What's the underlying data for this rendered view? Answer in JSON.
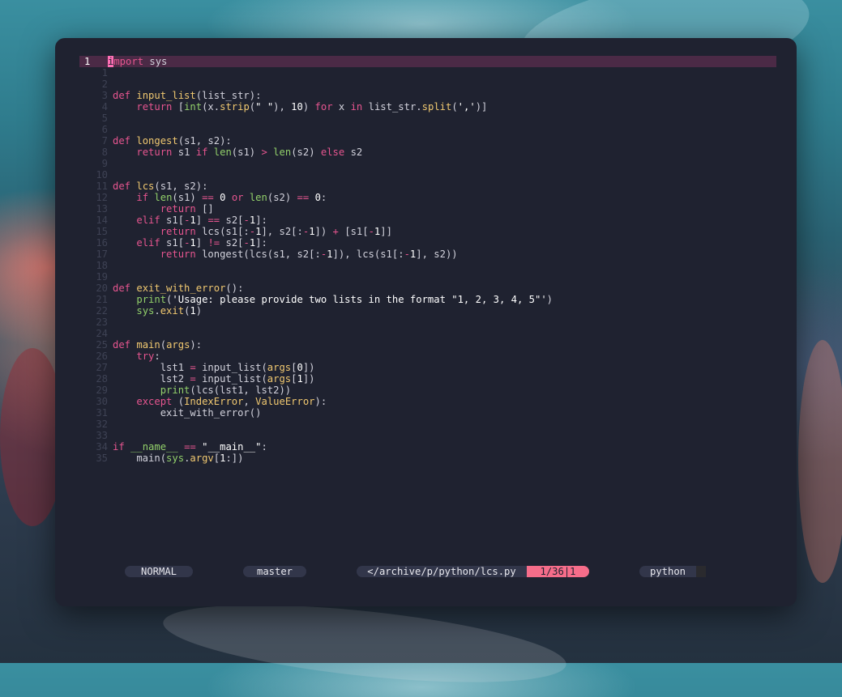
{
  "editor": {
    "current_line_number": "1",
    "lines": [
      {
        "n": "1",
        "tokens": [
          [
            "cursor",
            "i"
          ],
          [
            "kw",
            "mport"
          ],
          [
            "id",
            " sys"
          ]
        ]
      },
      {
        "n": "1",
        "tokens": []
      },
      {
        "n": "2",
        "tokens": []
      },
      {
        "n": "3",
        "tokens": [
          [
            "kw",
            "def"
          ],
          [
            "id",
            " "
          ],
          [
            "fn",
            "input_list"
          ],
          [
            "id",
            "(list_str):"
          ]
        ]
      },
      {
        "n": "4",
        "tokens": [
          [
            "id",
            "    "
          ],
          [
            "kw",
            "return"
          ],
          [
            "id",
            " ["
          ],
          [
            "bi",
            "int"
          ],
          [
            "id",
            "(x."
          ],
          [
            "fn",
            "strip"
          ],
          [
            "id",
            "("
          ],
          [
            "str",
            "\" \""
          ],
          [
            "id",
            "), "
          ],
          [
            "num",
            "10"
          ],
          [
            "id",
            ") "
          ],
          [
            "kw",
            "for"
          ],
          [
            "id",
            " x "
          ],
          [
            "kw",
            "in"
          ],
          [
            "id",
            " list_str."
          ],
          [
            "fn",
            "split"
          ],
          [
            "id",
            "("
          ],
          [
            "str",
            "','"
          ],
          [
            "id",
            ")]"
          ]
        ]
      },
      {
        "n": "5",
        "tokens": []
      },
      {
        "n": "6",
        "tokens": []
      },
      {
        "n": "7",
        "tokens": [
          [
            "kw",
            "def"
          ],
          [
            "id",
            " "
          ],
          [
            "fn",
            "longest"
          ],
          [
            "id",
            "(s1, s2):"
          ]
        ]
      },
      {
        "n": "8",
        "tokens": [
          [
            "id",
            "    "
          ],
          [
            "kw",
            "return"
          ],
          [
            "id",
            " s1 "
          ],
          [
            "kw",
            "if"
          ],
          [
            "id",
            " "
          ],
          [
            "bi",
            "len"
          ],
          [
            "id",
            "(s1) "
          ],
          [
            "op",
            ">"
          ],
          [
            "id",
            " "
          ],
          [
            "bi",
            "len"
          ],
          [
            "id",
            "(s2) "
          ],
          [
            "kw",
            "else"
          ],
          [
            "id",
            " s2"
          ]
        ]
      },
      {
        "n": "9",
        "tokens": []
      },
      {
        "n": "10",
        "tokens": []
      },
      {
        "n": "11",
        "tokens": [
          [
            "kw",
            "def"
          ],
          [
            "id",
            " "
          ],
          [
            "fn",
            "lcs"
          ],
          [
            "id",
            "(s1, s2):"
          ]
        ]
      },
      {
        "n": "12",
        "tokens": [
          [
            "id",
            "    "
          ],
          [
            "kw",
            "if"
          ],
          [
            "id",
            " "
          ],
          [
            "bi",
            "len"
          ],
          [
            "id",
            "(s1) "
          ],
          [
            "op",
            "=="
          ],
          [
            "id",
            " "
          ],
          [
            "num",
            "0"
          ],
          [
            "id",
            " "
          ],
          [
            "kw",
            "or"
          ],
          [
            "id",
            " "
          ],
          [
            "bi",
            "len"
          ],
          [
            "id",
            "(s2) "
          ],
          [
            "op",
            "=="
          ],
          [
            "id",
            " "
          ],
          [
            "num",
            "0"
          ],
          [
            "id",
            ":"
          ]
        ]
      },
      {
        "n": "13",
        "tokens": [
          [
            "id",
            "        "
          ],
          [
            "kw",
            "return"
          ],
          [
            "id",
            " []"
          ]
        ]
      },
      {
        "n": "14",
        "tokens": [
          [
            "id",
            "    "
          ],
          [
            "kw",
            "elif"
          ],
          [
            "id",
            " s1["
          ],
          [
            "op",
            "-"
          ],
          [
            "num",
            "1"
          ],
          [
            "id",
            "] "
          ],
          [
            "op",
            "=="
          ],
          [
            "id",
            " s2["
          ],
          [
            "op",
            "-"
          ],
          [
            "num",
            "1"
          ],
          [
            "id",
            "]:"
          ]
        ]
      },
      {
        "n": "15",
        "tokens": [
          [
            "id",
            "        "
          ],
          [
            "kw",
            "return"
          ],
          [
            "id",
            " lcs(s1[:"
          ],
          [
            "op",
            "-"
          ],
          [
            "num",
            "1"
          ],
          [
            "id",
            "], s2[:"
          ],
          [
            "op",
            "-"
          ],
          [
            "num",
            "1"
          ],
          [
            "id",
            "]) "
          ],
          [
            "op",
            "+"
          ],
          [
            "id",
            " [s1["
          ],
          [
            "op",
            "-"
          ],
          [
            "num",
            "1"
          ],
          [
            "id",
            "]]"
          ]
        ]
      },
      {
        "n": "16",
        "tokens": [
          [
            "id",
            "    "
          ],
          [
            "kw",
            "elif"
          ],
          [
            "id",
            " s1["
          ],
          [
            "op",
            "-"
          ],
          [
            "num",
            "1"
          ],
          [
            "id",
            "] "
          ],
          [
            "op",
            "!="
          ],
          [
            "id",
            " s2["
          ],
          [
            "op",
            "-"
          ],
          [
            "num",
            "1"
          ],
          [
            "id",
            "]:"
          ]
        ]
      },
      {
        "n": "17",
        "tokens": [
          [
            "id",
            "        "
          ],
          [
            "kw",
            "return"
          ],
          [
            "id",
            " longest(lcs(s1, s2[:"
          ],
          [
            "op",
            "-"
          ],
          [
            "num",
            "1"
          ],
          [
            "id",
            "]), lcs(s1[:"
          ],
          [
            "op",
            "-"
          ],
          [
            "num",
            "1"
          ],
          [
            "id",
            "], s2))"
          ]
        ]
      },
      {
        "n": "18",
        "tokens": []
      },
      {
        "n": "19",
        "tokens": []
      },
      {
        "n": "20",
        "tokens": [
          [
            "kw",
            "def"
          ],
          [
            "id",
            " "
          ],
          [
            "fn",
            "exit_with_error"
          ],
          [
            "id",
            "():"
          ]
        ]
      },
      {
        "n": "21",
        "tokens": [
          [
            "id",
            "    "
          ],
          [
            "bi",
            "print"
          ],
          [
            "id",
            "("
          ],
          [
            "str",
            "'Usage: please provide two lists in the format \"1, 2, 3, 4, 5\"'"
          ],
          [
            "id",
            ")"
          ]
        ]
      },
      {
        "n": "22",
        "tokens": [
          [
            "id",
            "    "
          ],
          [
            "bi",
            "sys"
          ],
          [
            "id",
            "."
          ],
          [
            "fn",
            "exit"
          ],
          [
            "id",
            "("
          ],
          [
            "num",
            "1"
          ],
          [
            "id",
            ")"
          ]
        ]
      },
      {
        "n": "23",
        "tokens": []
      },
      {
        "n": "24",
        "tokens": []
      },
      {
        "n": "25",
        "tokens": [
          [
            "kw",
            "def"
          ],
          [
            "id",
            " "
          ],
          [
            "fn",
            "main"
          ],
          [
            "id",
            "("
          ],
          [
            "fn",
            "args"
          ],
          [
            "id",
            "):"
          ]
        ]
      },
      {
        "n": "26",
        "tokens": [
          [
            "id",
            "    "
          ],
          [
            "kw",
            "try"
          ],
          [
            "id",
            ":"
          ]
        ]
      },
      {
        "n": "27",
        "tokens": [
          [
            "id",
            "        lst1 "
          ],
          [
            "op",
            "="
          ],
          [
            "id",
            " input_list("
          ],
          [
            "fn",
            "args"
          ],
          [
            "id",
            "["
          ],
          [
            "num",
            "0"
          ],
          [
            "id",
            "])"
          ]
        ]
      },
      {
        "n": "28",
        "tokens": [
          [
            "id",
            "        lst2 "
          ],
          [
            "op",
            "="
          ],
          [
            "id",
            " input_list("
          ],
          [
            "fn",
            "args"
          ],
          [
            "id",
            "["
          ],
          [
            "num",
            "1"
          ],
          [
            "id",
            "])"
          ]
        ]
      },
      {
        "n": "29",
        "tokens": [
          [
            "id",
            "        "
          ],
          [
            "bi",
            "print"
          ],
          [
            "id",
            "(lcs(lst1, lst2))"
          ]
        ]
      },
      {
        "n": "30",
        "tokens": [
          [
            "id",
            "    "
          ],
          [
            "kw",
            "except"
          ],
          [
            "id",
            " ("
          ],
          [
            "fn",
            "IndexError"
          ],
          [
            "id",
            ", "
          ],
          [
            "fn",
            "ValueError"
          ],
          [
            "id",
            "):"
          ]
        ]
      },
      {
        "n": "31",
        "tokens": [
          [
            "id",
            "        exit_with_error()"
          ]
        ]
      },
      {
        "n": "32",
        "tokens": []
      },
      {
        "n": "33",
        "tokens": []
      },
      {
        "n": "34",
        "tokens": [
          [
            "kw",
            "if"
          ],
          [
            "id",
            " "
          ],
          [
            "bi",
            "__name__"
          ],
          [
            "id",
            " "
          ],
          [
            "op",
            "=="
          ],
          [
            "id",
            " "
          ],
          [
            "str",
            "\"__main__\""
          ],
          [
            "id",
            ":"
          ]
        ]
      },
      {
        "n": "35",
        "tokens": [
          [
            "id",
            "    main("
          ],
          [
            "bi",
            "sys"
          ],
          [
            "id",
            "."
          ],
          [
            "fn",
            "argv"
          ],
          [
            "id",
            "["
          ],
          [
            "num",
            "1"
          ],
          [
            "id",
            ":])"
          ]
        ]
      }
    ]
  },
  "statusbar": {
    "mode": "NORMAL",
    "branch": "master",
    "path": "</archive/p/python/lcs.py",
    "position": "1/36⌐1",
    "position_text": "1/36|1",
    "filetype": "python"
  },
  "colors": {
    "keyword": "#e6558f",
    "function": "#f0c870",
    "builtin": "#92d06a",
    "cursor": "#ff6fb5",
    "current_line_bg": "#4b2a46",
    "position_bg": "#f66d8a",
    "editor_bg": "#1f2230"
  }
}
